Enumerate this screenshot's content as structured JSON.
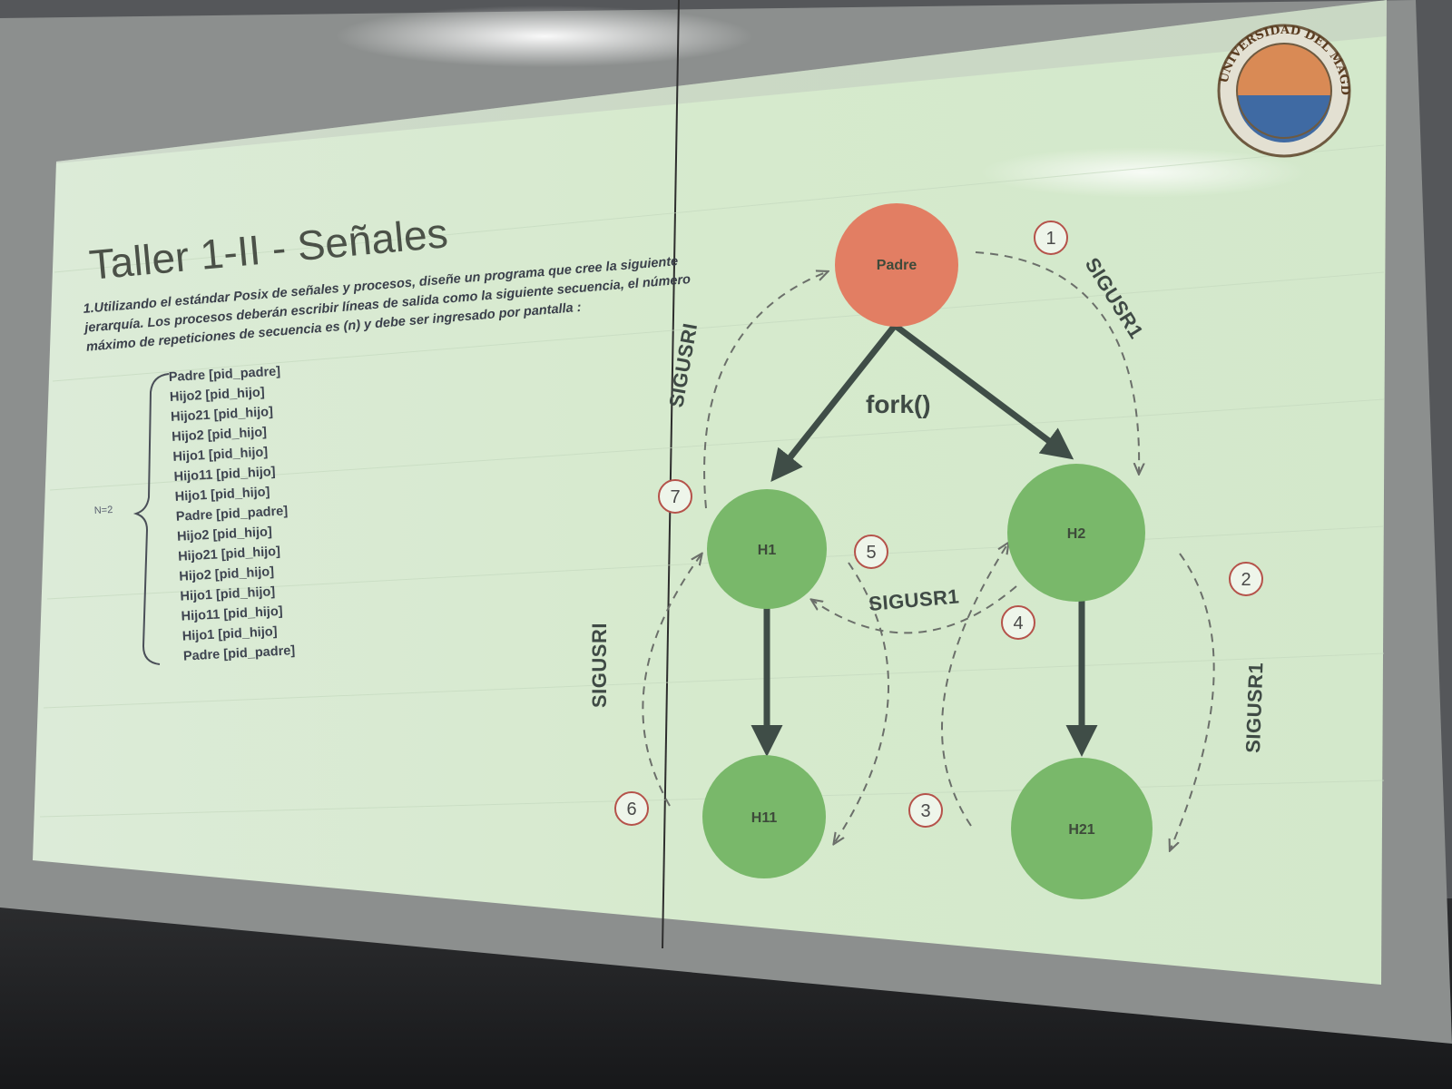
{
  "slide": {
    "title": "Taller 1-II - Señales",
    "paragraph": [
      "1.Utilizando el estándar Posix de señales y procesos, diseñe un programa que cree la siguiente",
      "jerarquía. Los procesos deberán escribir líneas de salida como la siguiente secuencia, el número",
      "máximo de repeticiones de secuencia es (n) y debe ser ingresado por pantalla :"
    ],
    "n_label": "N=2",
    "sequence": [
      "Padre  [pid_padre]",
      "Hijo2   [pid_hijo]",
      "Hijo21  [pid_hijo]",
      "Hijo2   [pid_hijo]",
      "Hijo1   [pid_hijo]",
      "Hijo11  [pid_hijo]",
      "Hijo1   [pid_hijo]",
      "Padre  [pid_padre]",
      "Hijo2   [pid_hijo]",
      "Hijo21  [pid_hijo]",
      "Hijo2   [pid_hijo]",
      "Hijo1   [pid_hijo]",
      "Hijo11  [pid_hijo]",
      "Hijo1   [pid_hijo]",
      "Padre  [pid_padre]"
    ]
  },
  "diagram": {
    "fork_label": "fork()",
    "nodes": {
      "padre": "Padre",
      "h1": "H1",
      "h2": "H2",
      "h11": "H11",
      "h21": "H21"
    },
    "signal_label": "SIGUSR1",
    "signal_label_alt": "SIGUSRI",
    "steps": [
      "1",
      "2",
      "3",
      "4",
      "5",
      "6",
      "7"
    ]
  },
  "logo": {
    "text": "UNIVERSIDAD DEL MAGDALENA"
  },
  "colors": {
    "slide_bg": "#dbebd6",
    "padre_node": "#e27e63",
    "child_node": "#79b86a",
    "arrow": "#3f4d47",
    "step_circle": "#b5524a"
  }
}
